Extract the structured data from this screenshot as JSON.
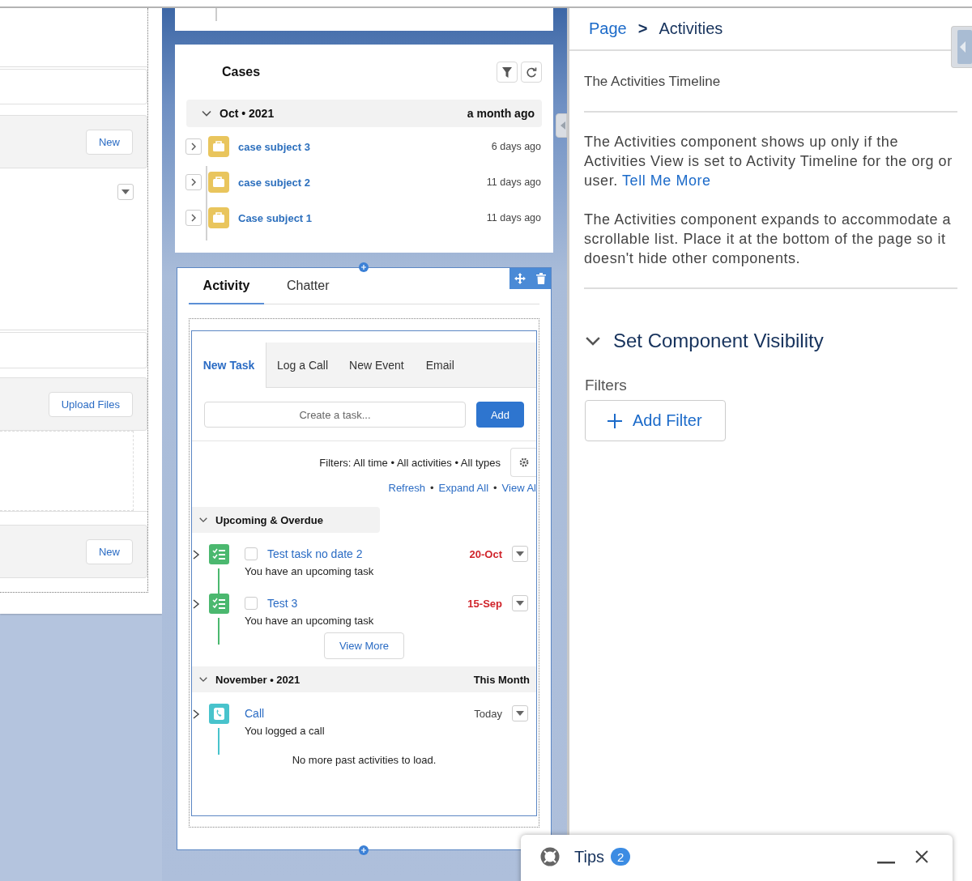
{
  "left_panel": {
    "top_button": "New",
    "upload_button": "Upload Files",
    "bottom_button": "New"
  },
  "cases": {
    "title": "Cases",
    "group": {
      "label": "Oct • 2021",
      "when": "a month ago",
      "expanded": true
    },
    "items": [
      {
        "subject": "case subject 3",
        "age": "6 days ago"
      },
      {
        "subject": "case subject 2",
        "age": "11 days ago"
      },
      {
        "subject": "Case subject 1",
        "age": "11 days ago"
      }
    ]
  },
  "activity_tabs": [
    {
      "label": "Activity",
      "selected": true
    },
    {
      "label": "Chatter",
      "selected": false
    }
  ],
  "composer": {
    "tabs": [
      {
        "label": "New Task",
        "selected": true
      },
      {
        "label": "Log a Call",
        "selected": false
      },
      {
        "label": "New Event",
        "selected": false
      },
      {
        "label": "Email",
        "selected": false
      }
    ],
    "input": {
      "placeholder": "Create a task..."
    },
    "add_button": "Add"
  },
  "filters": {
    "text": "Filters: All time • All activities • All types",
    "links": [
      {
        "label": "Refresh"
      },
      {
        "separator": "•",
        "label": "Expand All"
      },
      {
        "separator": "•",
        "label": "View Al"
      }
    ]
  },
  "groups": [
    {
      "kind": "upcoming",
      "title": "Upcoming & Overdue",
      "expanded": true,
      "more_button": "View More",
      "items": [
        {
          "kind": "task",
          "title": "Test task no date 2",
          "date": "20-Oct",
          "highlighted": true,
          "checked": false,
          "subtitle": "You have an upcoming task"
        },
        {
          "kind": "task",
          "title": "Test 3",
          "date": "15-Sep",
          "highlighted": true,
          "checked": false,
          "subtitle": "You have an upcoming task"
        }
      ]
    },
    {
      "kind": "month",
      "title": "November • 2021",
      "summary": "This Month",
      "expanded": true,
      "items": [
        {
          "kind": "call",
          "title": "Call",
          "date": "Today",
          "highlighted": false,
          "subtitle": "You logged a call"
        }
      ]
    }
  ],
  "empty_message": "No more past activities to load.",
  "properties": {
    "breadcrumb": {
      "parent": "Page",
      "separator": ">",
      "current": "Activities"
    },
    "heading": "The Activities Timeline",
    "paragraphs": [
      {
        "text": "The Activities component shows up only if the Activities View is set to Activity Timeline for the org or user.",
        "link": "Tell Me More"
      },
      {
        "text": "The Activities component expands to accommodate a scrollable list. Place it at the bottom of the page so it doesn't hide other components."
      }
    ],
    "visibility": {
      "title": "Set Component Visibility",
      "expanded": true,
      "filters_label": "Filters",
      "add_filter": "Add Filter"
    }
  },
  "tips": {
    "title": "Tips",
    "count": "2"
  }
}
